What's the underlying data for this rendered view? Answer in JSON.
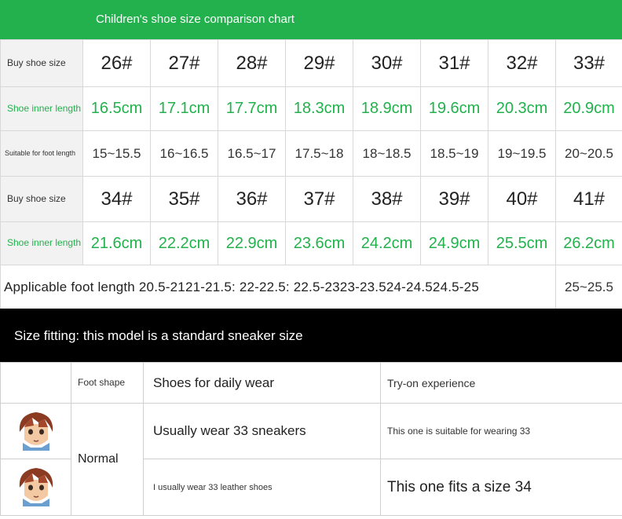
{
  "header": {
    "title": "Children's shoe size comparison chart"
  },
  "size_table": {
    "labels": {
      "buy_size": "Buy shoe size",
      "inner_length": "Shoe inner length",
      "suitable_foot": "Suitable for foot length",
      "applicable_foot": "Applicable foot length"
    },
    "sizes_1": [
      "26#",
      "27#",
      "28#",
      "29#",
      "30#",
      "31#",
      "32#",
      "33#"
    ],
    "inner_1": [
      "16.5cm",
      "17.1cm",
      "17.7cm",
      "18.3cm",
      "18.9cm",
      "19.6cm",
      "20.3cm",
      "20.9cm"
    ],
    "foot_1": [
      "15~15.5",
      "16~16.5",
      "16.5~17",
      "17.5~18",
      "18~18.5",
      "18.5~19",
      "19~19.5",
      "20~20.5"
    ],
    "sizes_2": [
      "34#",
      "35#",
      "36#",
      "37#",
      "38#",
      "39#",
      "40#",
      "41#"
    ],
    "inner_2": [
      "21.6cm",
      "22.2cm",
      "22.9cm",
      "23.6cm",
      "24.2cm",
      "24.9cm",
      "25.5cm",
      "26.2cm"
    ],
    "applicable_text": "Applicable foot length 20.5-2121-21.5: 22-22.5: 22.5-2323-23.524-24.524.5-25",
    "applicable_last": "25~25.5"
  },
  "fit_banner": {
    "text": "Size fitting: this model is a standard sneaker size"
  },
  "fit_table": {
    "headers": {
      "foot_shape": "Foot shape",
      "daily_wear": "Shoes for daily wear",
      "try_on": "Try-on experience"
    },
    "foot_type": "Normal",
    "rows": [
      {
        "daily": "Usually wear 33 sneakers",
        "experience": "This one is suitable for wearing 33"
      },
      {
        "daily": "I usually wear 33 leather shoes",
        "experience": "This one fits a size 34"
      }
    ]
  },
  "colors": {
    "accent_green": "#22b14c",
    "banner_black": "#000000"
  },
  "icons": {
    "avatar": "anime-face-avatar"
  }
}
